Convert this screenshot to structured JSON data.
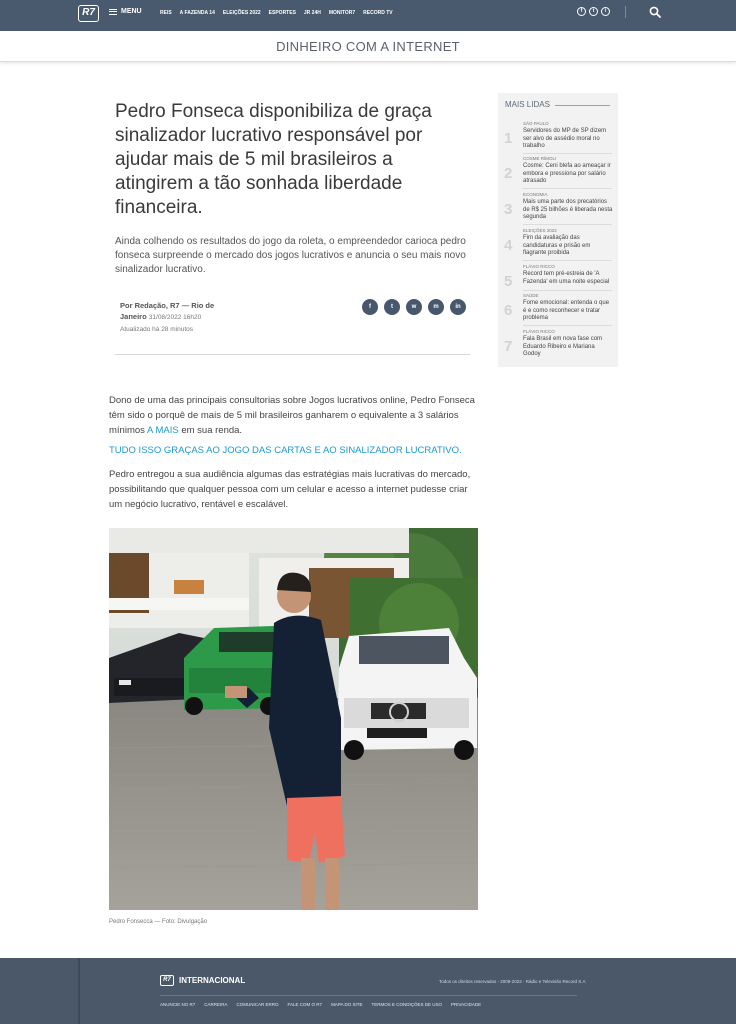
{
  "topbar": {
    "logo_text": "R7",
    "menu_label": "MENU",
    "links": [
      "REIS",
      "A FAZENDA 14",
      "ELEIÇÕES 2022",
      "ESPORTES",
      "JR 24H",
      "MONITOR7",
      "RECORD TV"
    ],
    "socials": [
      "f",
      "t",
      "i"
    ]
  },
  "section": {
    "title": "DINHEIRO COM A INTERNET"
  },
  "article": {
    "headline": "Pedro Fonseca disponibiliza de graça sinalizador lucrativo responsável por ajudar mais de 5 mil brasileiros a atingirem a tão sonhada liberdade financeira.",
    "subhead": "Ainda colhendo os resultados do jogo da roleta, o empreendedor carioca pedro fonseca surpreende o mercado dos jogos lucrativos e anuncia o seu mais novo sinalizador lucrativo.",
    "author": "Por Redação, R7 — Rio de Janeiro",
    "date": "31/08/2022 16h20",
    "updated": "Atualizado há 28 minutos",
    "share_icons": [
      "f",
      "t",
      "w",
      "m",
      "in"
    ],
    "p1_text": "Dono de uma das principais consultorias sobre Jogos lucrativos online, Pedro Fonseca têm sido o porquê de mais de 5 mil brasileiros ganharem o equivalente a 3 salários mínimos ",
    "p1_link": "A MAIS",
    "p1_end": " em sua renda.",
    "highlight": "TUDO ISSO GRAÇAS AO JOGO DAS CARTAS E AO SINALIZADOR LUCRATIVO.",
    "p3": "Pedro entregou a sua audiência algumas das estratégias mais lucrativas do mercado, possibilitando que qualquer pessoa com um celular e acesso a internet pudesse criar um negócio lucrativo, rentável e escalável.",
    "caption": "Pedro Fonsecca — Foto: Divulgação"
  },
  "sidebar": {
    "title": "MAIS LIDAS",
    "items": [
      {
        "num": "1",
        "category": "SÃO PAULO",
        "text": "Servidores do MP de SP dizem ser alvo de assédio moral no trabalho"
      },
      {
        "num": "2",
        "category": "COSME RÍMOLI",
        "text": "Cosme: Ceni blefa ao ameaçar ir embora e pressiona por salário atrasado"
      },
      {
        "num": "3",
        "category": "ECONOMIA",
        "text": "Mais uma parte dos precatórios de R$ 25 bilhões é liberada nesta segunda"
      },
      {
        "num": "4",
        "category": "ELEIÇÕES 2022",
        "text": "Fim da avaliação das candidaturas e prisão em flagrante proibida"
      },
      {
        "num": "5",
        "category": "FLÁVIO RICCO",
        "text": "Record tem pré-estreia de 'A Fazenda' em uma noite especial"
      },
      {
        "num": "6",
        "category": "SAÚDE",
        "text": "Fome emocional: entenda o que é e como reconhecer e tratar problema"
      },
      {
        "num": "7",
        "category": "FLÁVIO RICCO",
        "text": "Fala Brasil em nova fase com Eduardo Ribeiro e Mariana Godoy"
      }
    ]
  },
  "footer": {
    "logo_text": "R7",
    "brand": "INTERNACIONAL",
    "copyright": "Todos os direitos reservados - 2009-2022 - Rádio e Televisão Record S.A",
    "links": [
      "ANUNCIE NO R7",
      "CARREIRA",
      "COMUNICAR ERRO",
      "FALE COM O R7",
      "MAPA DO SITE",
      "TERMOS E CONDIÇÕES DE USO",
      "PRIVACIDADE"
    ]
  },
  "colors": {
    "nav_bg": "#495a6e",
    "accent_link": "#1b9ad2",
    "footer_bg": "#4a5869",
    "sidebar_bg": "#f2f2f2"
  }
}
